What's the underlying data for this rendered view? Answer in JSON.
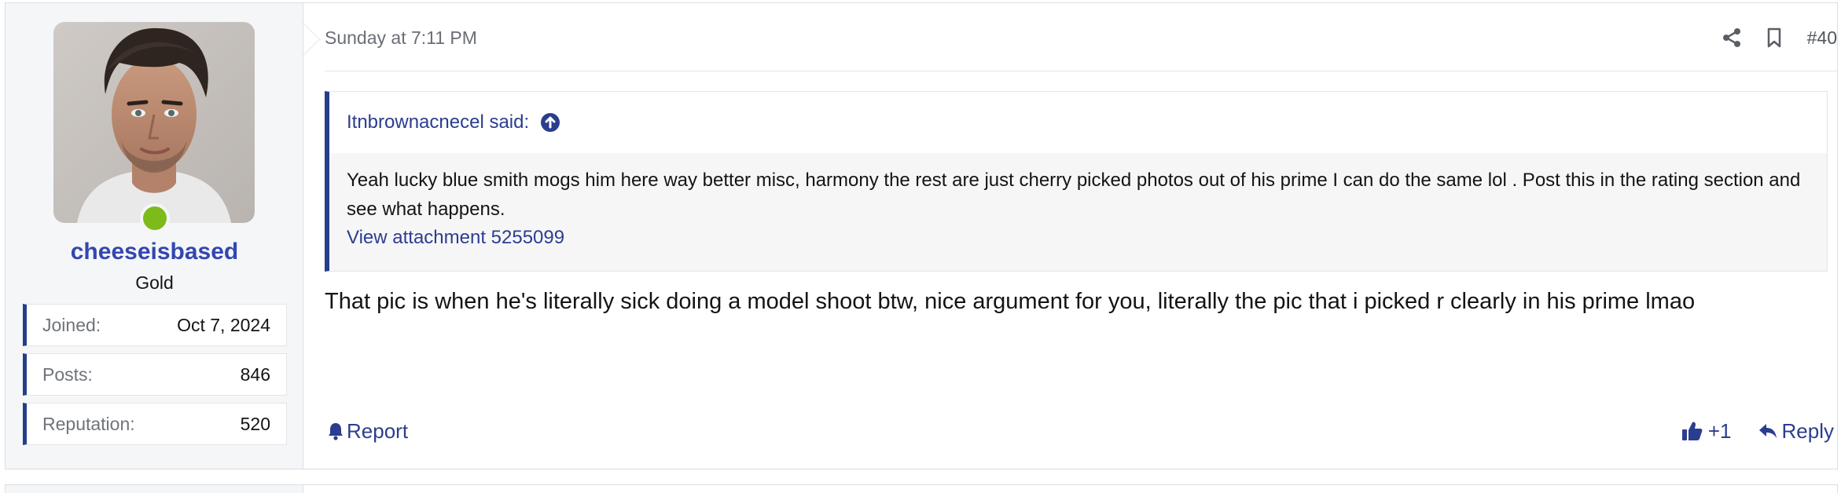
{
  "user": {
    "username": "cheeseisbased",
    "title": "Gold",
    "online": true,
    "stats": [
      {
        "label": "Joined:",
        "value": "Oct 7, 2024"
      },
      {
        "label": "Posts:",
        "value": "846"
      },
      {
        "label": "Reputation:",
        "value": "520"
      }
    ]
  },
  "post": {
    "timestamp": "Sunday at 7:11 PM",
    "number": "#40",
    "share_icon": "share-icon",
    "bookmark_icon": "bookmark-icon"
  },
  "quote": {
    "author_line": "Itnbrownacnecel said:",
    "text": "Yeah lucky blue smith mogs him here way better misc, harmony the rest are just cherry picked photos out of his prime I can do the same lol . Post this in the rating section and see what happens.",
    "attachment_link": "View attachment 5255099"
  },
  "message": "That pic is when he's literally sick doing a model shoot btw, nice argument for you, literally the pic that i picked r clearly in his prime lmao",
  "footer": {
    "report_label": "Report",
    "like_label": "+1",
    "reply_label": "Reply"
  },
  "colors": {
    "accent": "#233f8a",
    "link": "#2b3d8f",
    "username": "#3446b0",
    "online": "#7dbb1a"
  }
}
